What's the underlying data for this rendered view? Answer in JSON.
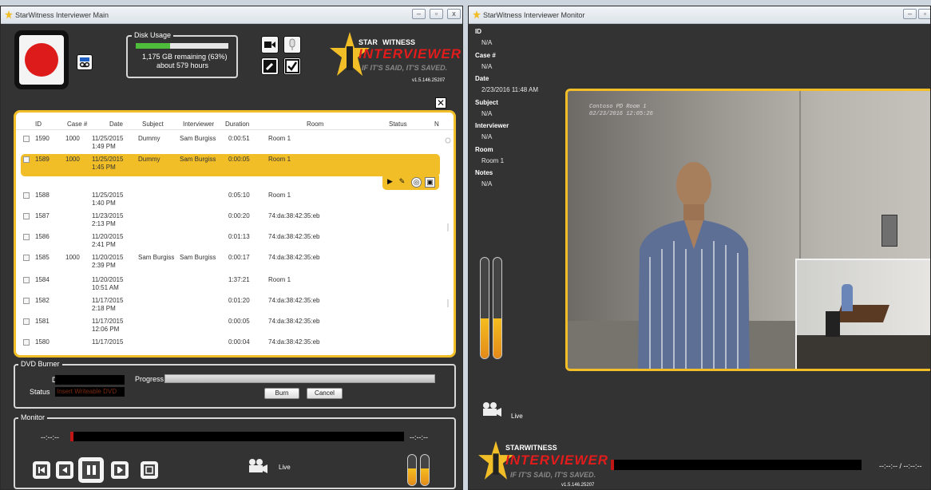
{
  "main_window": {
    "title": "StarWitness Interviewer Main",
    "disk": {
      "legend": "Disk Usage",
      "remaining": "1,175 GB remaining (63%)",
      "hours": "about 579 hours",
      "used_fraction": 0.37
    },
    "logo": {
      "star": "STAR",
      "witness": "WITNESS",
      "name": "INTERVIEWER",
      "tagline": "IF IT'S SAID, IT'S SAVED.",
      "version": "v1.5.146.25207"
    },
    "list": {
      "columns": [
        "ID",
        "Case #",
        "Date",
        "Subject",
        "Interviewer",
        "Duration",
        "Room",
        "Status",
        "N"
      ],
      "rows": [
        {
          "id": "1590",
          "case": "1000",
          "date1": "11/25/2015",
          "date2": "1:49 PM",
          "subject": "Dummy",
          "interviewer": "Sam Burgiss",
          "duration": "0:00:51",
          "room": "Room 1"
        },
        {
          "id": "1589",
          "case": "1000",
          "date1": "11/25/2015",
          "date2": "1:45 PM",
          "subject": "Dummy",
          "interviewer": "Sam Burgiss",
          "duration": "0:00:05",
          "room": "Room 1"
        },
        {
          "id": "1588",
          "case": "",
          "date1": "11/25/2015",
          "date2": "1:40 PM",
          "subject": "",
          "interviewer": "",
          "duration": "0:05:10",
          "room": "Room 1"
        },
        {
          "id": "1587",
          "case": "",
          "date1": "11/23/2015",
          "date2": "2:13 PM",
          "subject": "",
          "interviewer": "",
          "duration": "0:00:20",
          "room": "74:da:38:42:35:eb"
        },
        {
          "id": "1586",
          "case": "",
          "date1": "11/20/2015",
          "date2": "2:41 PM",
          "subject": "",
          "interviewer": "",
          "duration": "0:01:13",
          "room": "74:da:38:42:35:eb"
        },
        {
          "id": "1585",
          "case": "1000",
          "date1": "11/20/2015",
          "date2": "2:39 PM",
          "subject": "Sam Burgiss",
          "interviewer": "Sam Burgiss",
          "duration": "0:00:17",
          "room": "74:da:38:42:35:eb"
        },
        {
          "id": "1584",
          "case": "",
          "date1": "11/20/2015",
          "date2": "10:51 AM",
          "subject": "",
          "interviewer": "",
          "duration": "1:37:21",
          "room": "Room 1"
        },
        {
          "id": "1582",
          "case": "",
          "date1": "11/17/2015",
          "date2": "2:18 PM",
          "subject": "",
          "interviewer": "",
          "duration": "0:01:20",
          "room": "74:da:38:42:35:eb"
        },
        {
          "id": "1581",
          "case": "",
          "date1": "11/17/2015",
          "date2": "12:06 PM",
          "subject": "",
          "interviewer": "",
          "duration": "0:00:05",
          "room": "74:da:38:42:35:eb"
        },
        {
          "id": "1580",
          "case": "",
          "date1": "11/17/2015",
          "date2": "",
          "subject": "",
          "interviewer": "",
          "duration": "0:00:04",
          "room": "74:da:38:42:35:eb"
        }
      ]
    },
    "dvd": {
      "legend": "DVD Burner",
      "disc_label": "Disc",
      "status_label": "Status",
      "status_value": "Insert Writeable DVD",
      "progress_label": "Progress",
      "burn": "Burn",
      "cancel": "Cancel"
    },
    "monitor": {
      "legend": "Monitor",
      "time_left": "--:--:--",
      "time_right": "--:--:--",
      "live": "Live"
    }
  },
  "monitor_window": {
    "title": "StarWitness Interviewer Monitor",
    "fields": [
      {
        "label": "ID",
        "value": "N/A"
      },
      {
        "label": "Case #",
        "value": "N/A"
      },
      {
        "label": "Date",
        "value": "2/23/2016 11:48 AM"
      },
      {
        "label": "Subject",
        "value": "N/A"
      },
      {
        "label": "Interviewer",
        "value": "N/A"
      },
      {
        "label": "Room",
        "value": "Room 1"
      },
      {
        "label": "Notes",
        "value": "N/A"
      }
    ],
    "overlay": {
      "line1": "Contoso PD Room 1",
      "line2": "02/23/2016 12:05:26"
    },
    "live": "Live",
    "time": "--:--:-- / --:--:--",
    "logo": {
      "witness": "STARWITNESS",
      "name": "INTERVIEWER",
      "tagline": "IF IT'S SAID, IT'S SAVED.",
      "version": "v1.5.146.25207"
    }
  }
}
